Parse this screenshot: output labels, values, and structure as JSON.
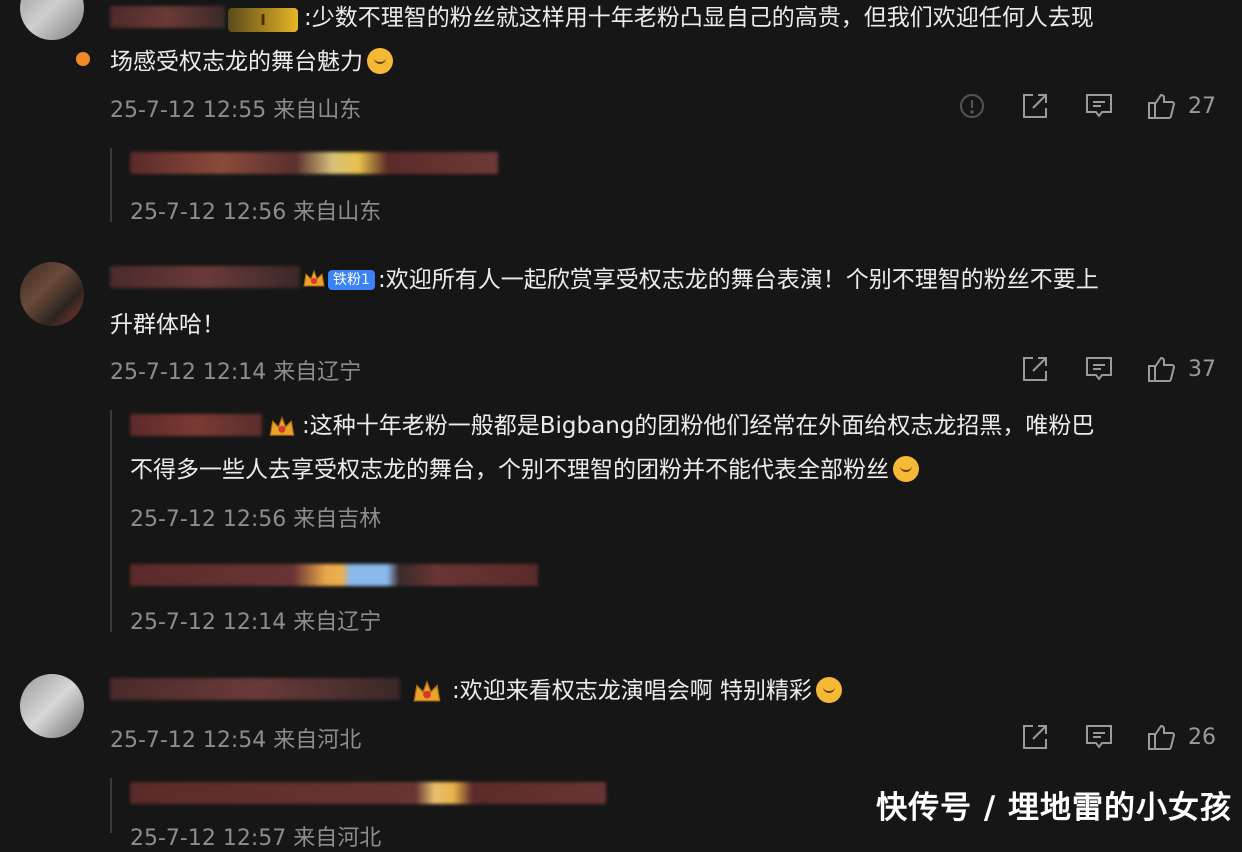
{
  "comments": [
    {
      "text_line1": ":少数不理智的粉丝就这样用十年老粉凸显自己的高贵，但我们欢迎任何人去现",
      "text_line2": "场感受权志龙的舞台魅力",
      "meta": "25-7-12 12:55 来自山东",
      "likes": "27",
      "badge_label": "I",
      "reply": {
        "meta": "25-7-12 12:56 来自山东"
      }
    },
    {
      "text_line1": ":欢迎所有人一起欣赏享受权志龙的舞台表演！个别不理智的粉丝不要上",
      "text_line2": "升群体哈！",
      "badge_label": "铁粉1",
      "meta": "25-7-12 12:14 来自辽宁",
      "likes": "37",
      "replies": [
        {
          "text_line1": ":这种十年老粉一般都是Bigbang的团粉他们经常在外面给权志龙招黑，唯粉巴",
          "text_line2": "不得多一些人去享受权志龙的舞台，个别不理智的团粉并不能代表全部粉丝",
          "meta": "25-7-12 12:56 来自吉林"
        },
        {
          "meta": "25-7-12 12:14 来自辽宁"
        }
      ]
    },
    {
      "text_line1": ":欢迎来看权志龙演唱会啊 特别精彩",
      "meta": "25-7-12 12:54 来自河北",
      "likes": "26",
      "reply": {
        "meta": "25-7-12 12:57 来自河北"
      }
    }
  ],
  "icons": [
    "report-icon",
    "share-icon",
    "comment-icon",
    "like-icon",
    "crown-icon"
  ],
  "watermark": "快传号 / 埋地雷的小女孩",
  "colors": {
    "background": "#161616",
    "meta": "#8d8d8d",
    "text": "#ececec",
    "badge": "#3b82f6"
  }
}
